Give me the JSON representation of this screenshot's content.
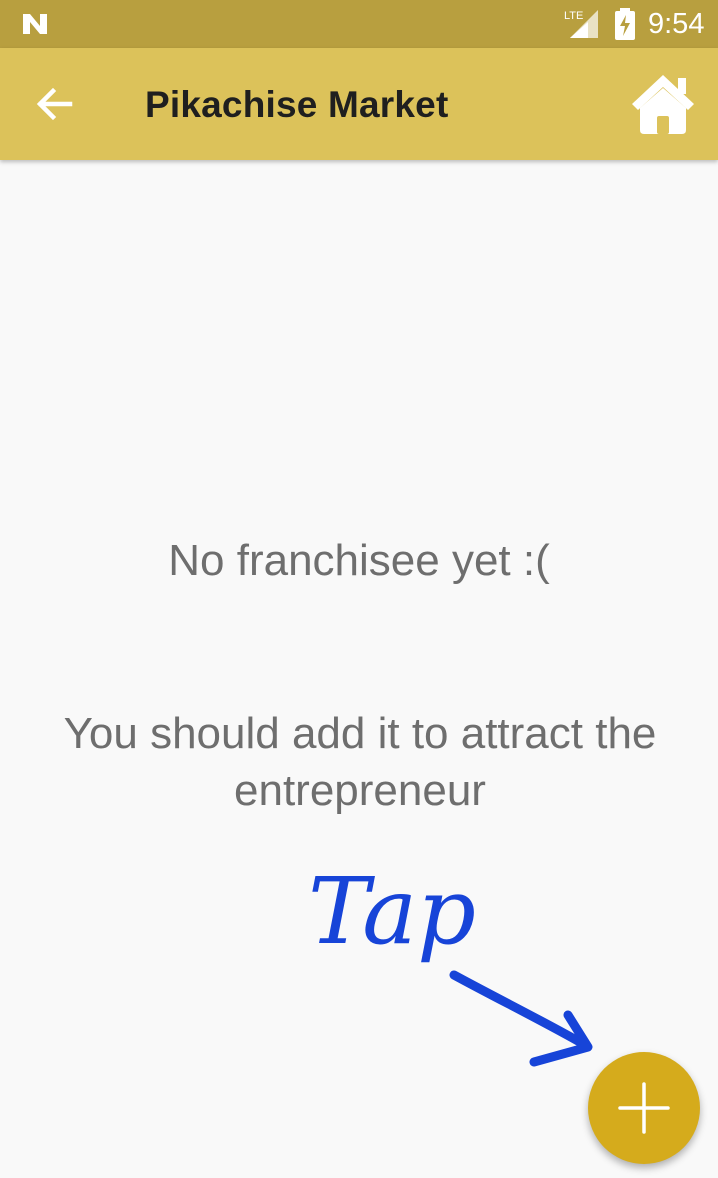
{
  "status_bar": {
    "time": "9:54",
    "network_label": "LTE",
    "icons": [
      "n-logo-icon",
      "lte-signal-icon",
      "battery-charging-icon"
    ]
  },
  "app_bar": {
    "title": "Pikachise Market",
    "back_icon": "arrow-left-icon",
    "home_icon": "home-icon"
  },
  "empty_state": {
    "title": "No franchisee yet :(",
    "subtitle": "You should add it to attract the entrepreneur"
  },
  "annotation": {
    "text": "Tap",
    "color": "#1744d8"
  },
  "fab": {
    "icon": "plus-icon",
    "color": "#d5ab1c"
  },
  "colors": {
    "status_bar": "#b89f3f",
    "app_bar": "#dcc25a",
    "background": "#f9f9f9",
    "text_muted": "#6e6e6e"
  }
}
